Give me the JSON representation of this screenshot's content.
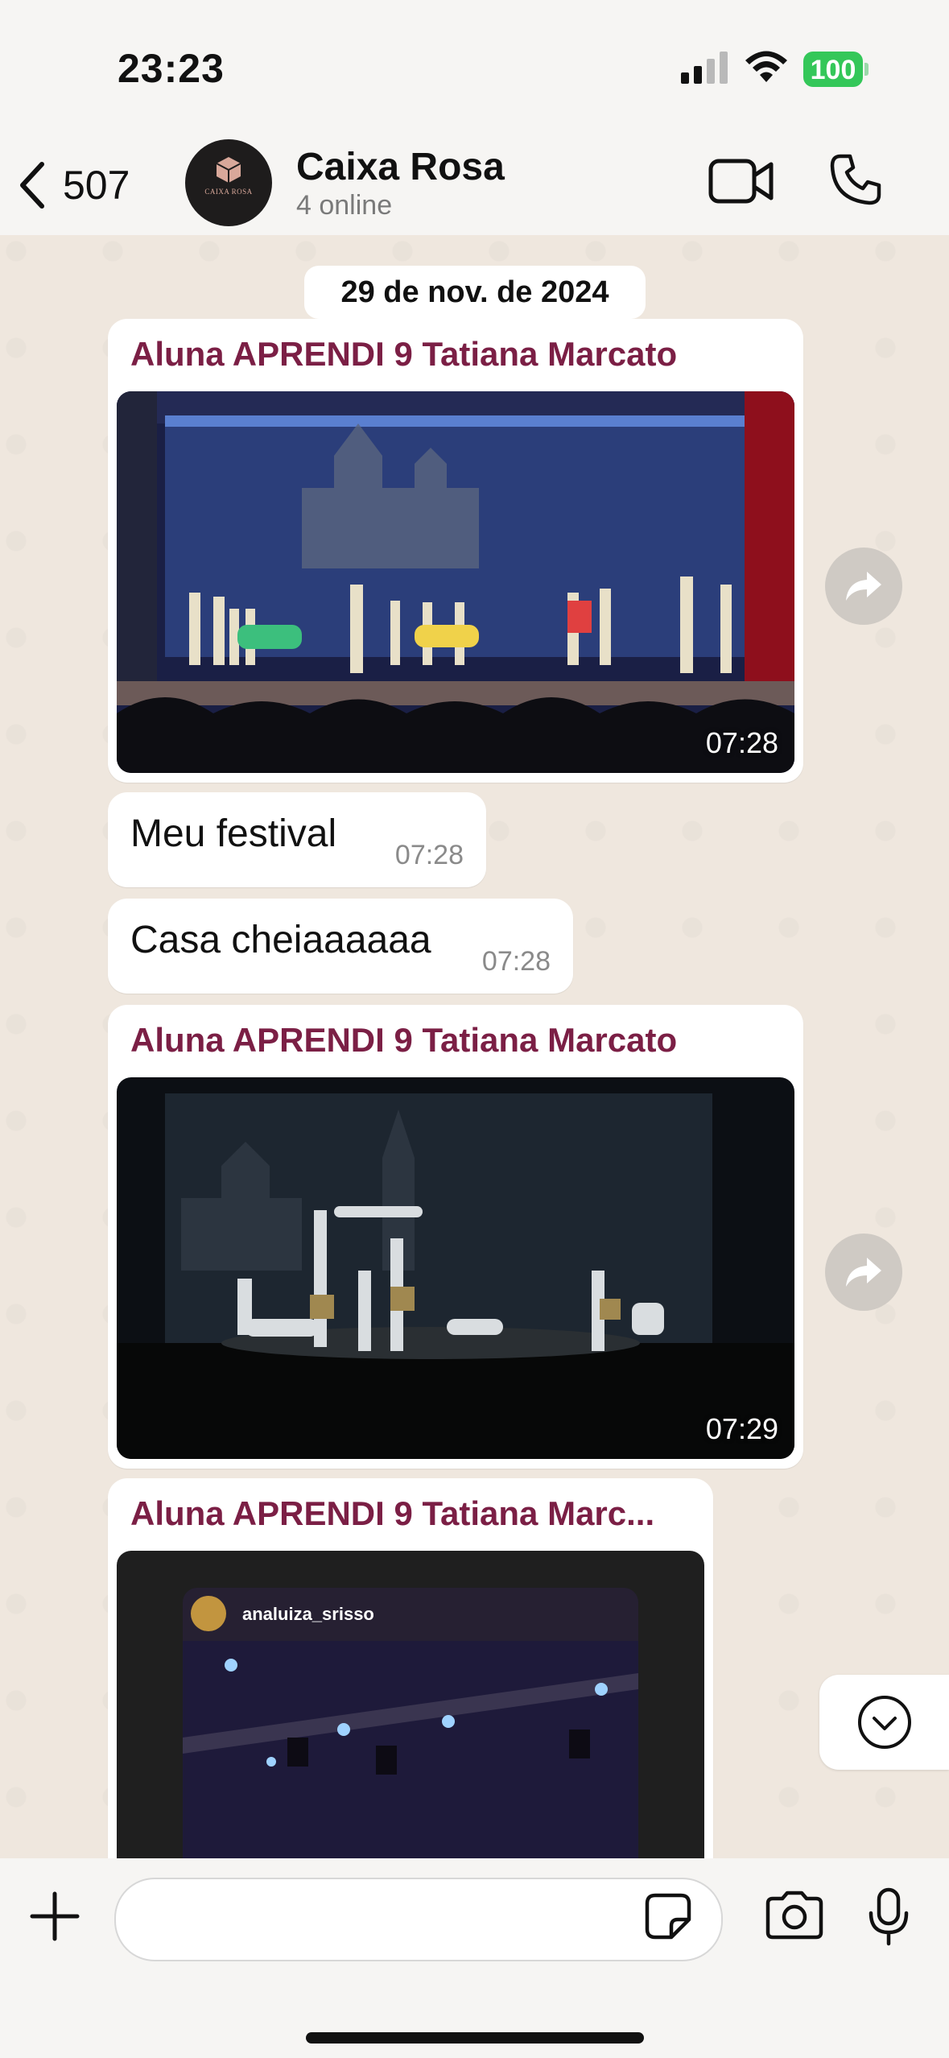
{
  "status_bar": {
    "time": "23:23",
    "battery": "100"
  },
  "header": {
    "back_count": "507",
    "title": "Caixa Rosa",
    "subtitle": "4 online",
    "avatar_text": "CAIXA ROSA"
  },
  "chat": {
    "date": "29 de nov. de 2024",
    "messages": [
      {
        "sender": "Aluna APRENDI 9 Tatiana Marcato",
        "type": "video",
        "time": "07:28"
      },
      {
        "type": "text",
        "text": "Meu festival",
        "time": "07:28"
      },
      {
        "type": "text",
        "text": "Casa cheiaaaaaa",
        "time": "07:28"
      },
      {
        "sender": "Aluna APRENDI 9 Tatiana Marcato",
        "type": "video",
        "time": "07:29"
      },
      {
        "sender": "Aluna APRENDI 9 Tatiana Marc...",
        "type": "story",
        "story_user": "analuiza_srisso"
      }
    ]
  },
  "composer": {
    "placeholder": ""
  },
  "colors": {
    "sender": "#7b1f45",
    "battery": "#34c759",
    "bubble": "#ffffff",
    "background": "#efe7de"
  },
  "icons": [
    "chevron-left-icon",
    "video-camera-icon",
    "phone-icon",
    "forward-icon",
    "chevron-down-icon",
    "plus-icon",
    "sticker-icon",
    "camera-icon",
    "microphone-icon"
  ]
}
